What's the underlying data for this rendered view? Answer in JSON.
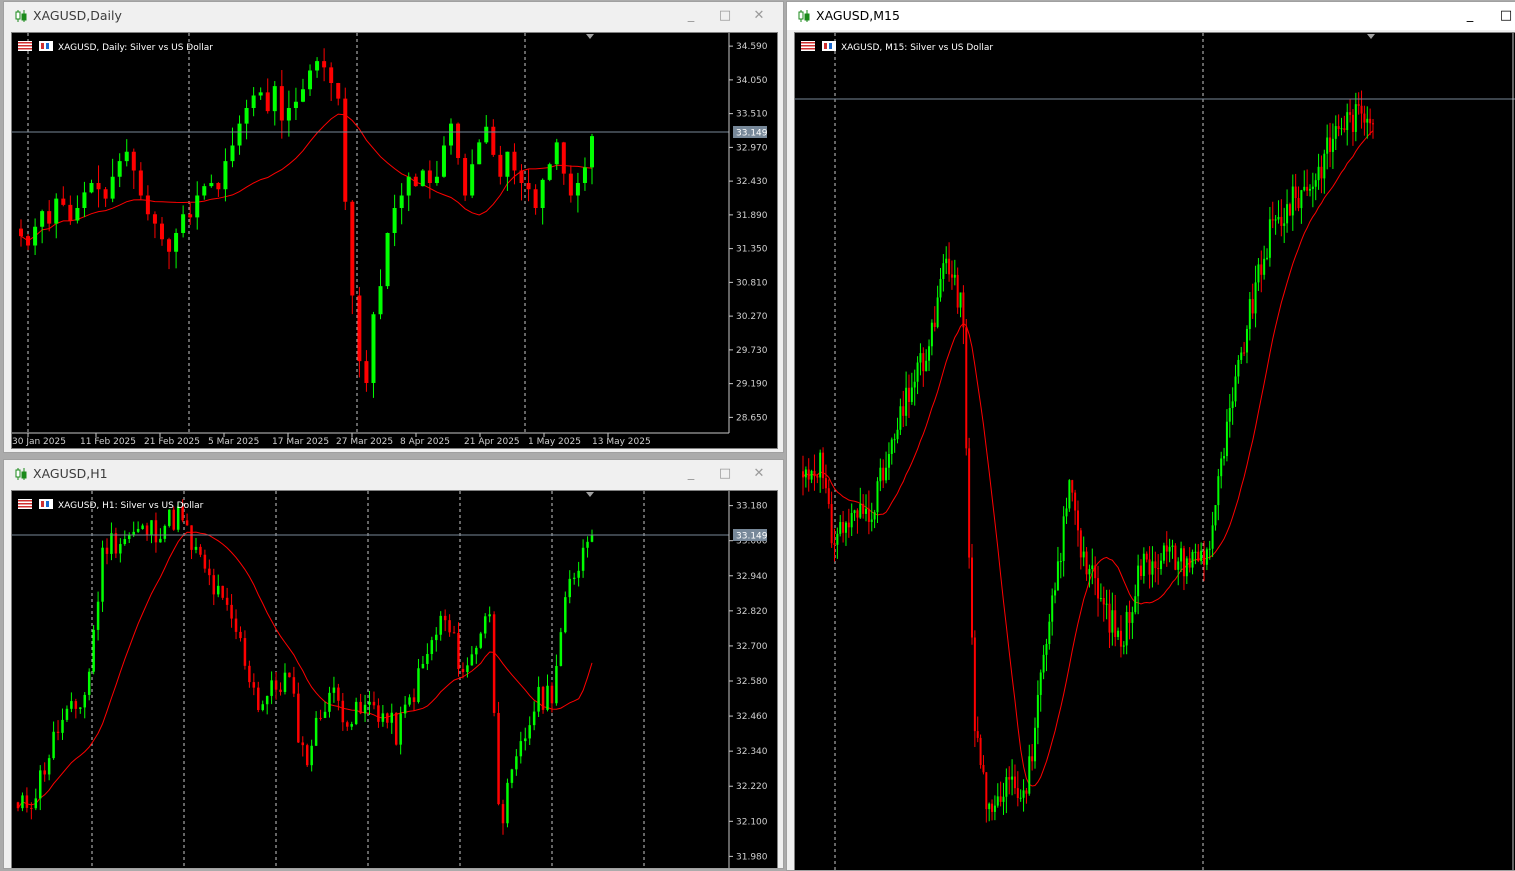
{
  "windows": {
    "daily": {
      "title": "XAGUSD,Daily",
      "chart_label": "XAGUSD, Daily:  Silver vs US Dollar",
      "current_price": "33.149",
      "price_levels": [
        "34.590",
        "34.050",
        "33.510",
        "32.970",
        "32.430",
        "31.890",
        "31.350",
        "30.810",
        "30.270",
        "29.730",
        "29.190",
        "28.650"
      ],
      "date_labels": [
        "30 Jan 2025",
        "11 Feb 2025",
        "21 Feb 2025",
        "5 Mar 2025",
        "17 Mar 2025",
        "27 Mar 2025",
        "8 Apr 2025",
        "21 Apr 2025",
        "1 May 2025",
        "13 May 2025"
      ]
    },
    "h1": {
      "title": "XAGUSD,H1",
      "chart_label": "XAGUSD, H1:  Silver vs US Dollar",
      "current_price": "33.149",
      "price_levels": [
        "33.180",
        "33.060",
        "32.940",
        "32.820",
        "32.700",
        "32.580",
        "32.460",
        "32.340",
        "32.220",
        "32.100",
        "31.980"
      ]
    },
    "m15": {
      "title": "XAGUSD,M15",
      "chart_label": "XAGUSD, M15:  Silver vs US Dollar"
    }
  },
  "buttons": {
    "minimize": "_",
    "maximize": "□",
    "close": "✕"
  },
  "colors": {
    "bull": "#00ff00",
    "bear": "#ff0000",
    "ma": "#ff0000",
    "chart_bg": "#000000",
    "grid": "#c8c8c8",
    "price_line": "#778899"
  },
  "chart_data": [
    {
      "type": "candlestick",
      "title": "XAGUSD, Daily:  Silver vs US Dollar",
      "ylim": [
        28.4,
        34.8
      ],
      "closes": [
        31.55,
        31.4,
        31.7,
        31.95,
        31.75,
        32.15,
        32.05,
        31.8,
        32.0,
        32.25,
        32.4,
        32.3,
        32.15,
        32.5,
        32.75,
        32.9,
        32.6,
        32.2,
        31.9,
        31.75,
        31.5,
        31.3,
        31.6,
        31.9,
        31.85,
        32.2,
        32.35,
        32.4,
        32.3,
        32.75,
        33.0,
        33.35,
        33.6,
        33.8,
        33.85,
        33.55,
        33.95,
        33.4,
        33.6,
        33.7,
        33.9,
        34.2,
        34.35,
        34.25,
        34.0,
        33.75,
        32.1,
        30.6,
        29.55,
        29.2,
        30.3,
        30.75,
        31.6,
        32.0,
        32.2,
        32.5,
        32.35,
        32.6,
        32.4,
        32.5,
        33.0,
        33.35,
        32.8,
        32.2,
        32.7,
        33.05,
        33.3,
        32.85,
        32.5,
        32.9,
        32.6,
        32.4,
        32.3,
        32.0,
        32.45,
        32.7,
        33.05,
        32.55,
        32.2,
        32.4,
        32.65,
        33.15
      ],
      "ma_period": 20
    },
    {
      "type": "candlestick",
      "title": "XAGUSD, H1:  Silver vs US Dollar",
      "ylim": [
        31.93,
        33.23
      ],
      "ma_period": 20
    },
    {
      "type": "candlestick",
      "title": "XAGUSD, M15:  Silver vs US Dollar",
      "ma_period": 20
    }
  ]
}
